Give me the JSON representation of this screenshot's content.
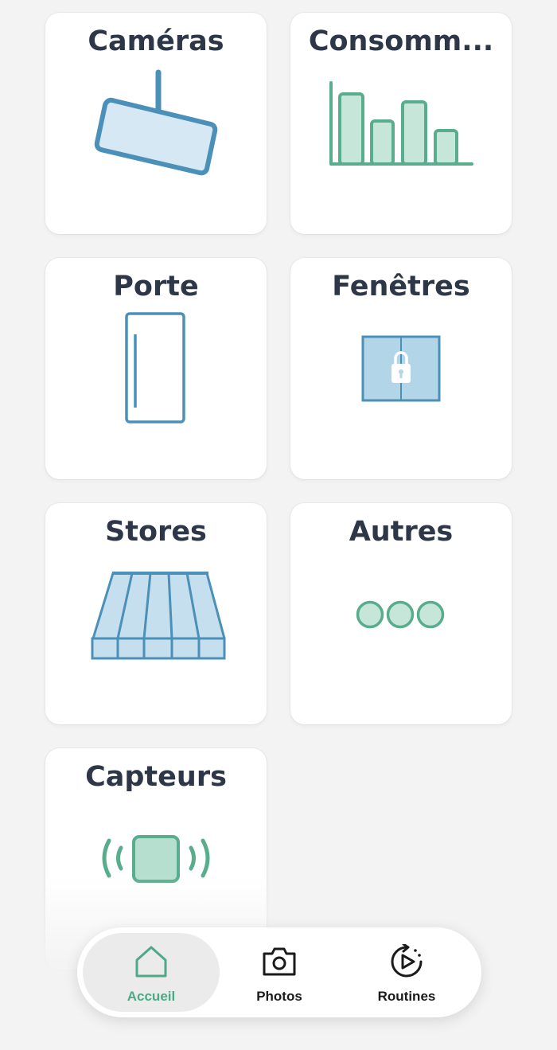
{
  "tiles": [
    {
      "label": "Caméras",
      "icon": "security-camera-icon"
    },
    {
      "label": "Consomm...",
      "icon": "bar-chart-icon"
    },
    {
      "label": "Porte",
      "icon": "door-icon"
    },
    {
      "label": "Fenêtres",
      "icon": "window-lock-icon"
    },
    {
      "label": "Stores",
      "icon": "awning-blinds-icon"
    },
    {
      "label": "Autres",
      "icon": "more-dots-icon"
    },
    {
      "label": "Capteurs",
      "icon": "sensor-icon"
    }
  ],
  "tabbar": {
    "items": [
      {
        "label": "Accueil",
        "icon": "home-icon",
        "active": true
      },
      {
        "label": "Photos",
        "icon": "camera-icon",
        "active": false
      },
      {
        "label": "Routines",
        "icon": "routine-play-icon",
        "active": false
      }
    ]
  },
  "colors": {
    "background": "#f3f3f4",
    "title_text": "#2e3748",
    "blue_stroke": "#4a90b8",
    "blue_fill": "#d5e8f3",
    "green_stroke": "#58ad8c",
    "green_fill": "#c6e6d9",
    "active_tab_text": "#4fa886"
  }
}
